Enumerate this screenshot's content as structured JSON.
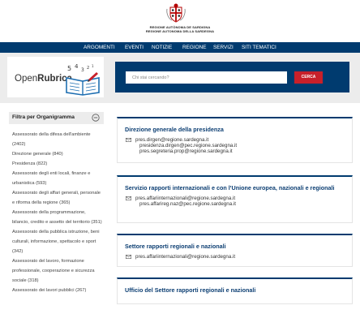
{
  "header": {
    "region_line1": "REGIONE AUTÒNOMA DE SARDIGNA",
    "region_line2": "REGIONE AUTONOMA DELLA SARDEGNA"
  },
  "nav": {
    "items": [
      "ARGOMENTI",
      "EVENTI",
      "NOTIZIE",
      "REGIONE",
      "SERVIZI",
      "SITI TEMATICI"
    ]
  },
  "brand": {
    "logo_light": "Open",
    "logo_bold": "Rubrica",
    "logo_icon": "open-book-icon"
  },
  "search": {
    "placeholder": "Chi stai cercando?",
    "button": "CERCA"
  },
  "filter": {
    "title": "Filtra per Organigramma",
    "lines": [
      "Assessorato della difesa dell'ambiente",
      "(2402)",
      "Direzione generale (840)",
      "Presidenza (822)",
      "Assessorato degli enti locali, finanze e",
      "urbanistica (593)",
      "Assessorato degli affari generali, personale",
      "e riforma della regione (365)",
      "Assessorato della programmazione,",
      "bilancio, credito e assetto del territorio (351)",
      "Assessorato della pubblica istruzione, beni",
      "culturali, informazione, spettacolo e sport",
      "(342)",
      "Assessorato del lavoro, formazione",
      "professionale, cooperazione e sicurezza",
      "sociale (318)",
      "Assessorato dei lavori pubblici (267)"
    ]
  },
  "results": [
    {
      "title": "Direzione generale della presidenza",
      "emails": [
        "pres.dirgen@regione.sardegna.it",
        "presidenza.dirgen@pec.regione.sardegna.it",
        "pres.segreteria.prop@regione.sardegna.it"
      ]
    },
    {
      "title": "Servizio rapporti internazionali e con l'Unione europea, nazionali e regionali",
      "emails": [
        "pres.affariinternazionali@regione.sardegna.it",
        "pres.affarireg.naz@pec.regione.sardegna.it"
      ]
    },
    {
      "title": "Settore rapporti regionali e nazionali",
      "emails": [
        "pres.affariinternazionali@regione.sardegna.it"
      ]
    },
    {
      "title": "Ufficio del Settore rapporti regionali e nazionali",
      "emails": []
    }
  ],
  "colors": {
    "nav_blue": "#003b6f",
    "accent_red": "#c8202a",
    "title_blue": "#0d3f73",
    "band_gray": "#ececec"
  }
}
